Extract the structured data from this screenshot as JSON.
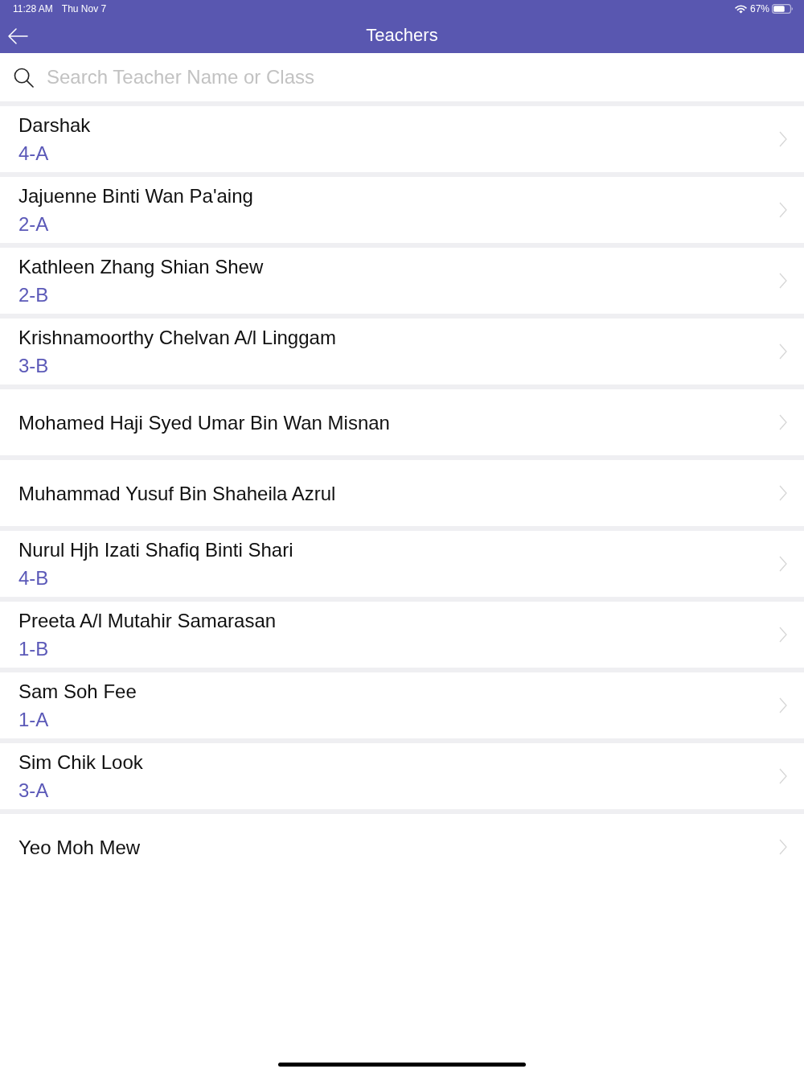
{
  "status_bar": {
    "time": "11:28 AM",
    "date": "Thu Nov 7",
    "battery": "67%"
  },
  "nav_bar": {
    "title": "Teachers"
  },
  "search": {
    "placeholder": "Search Teacher Name or Class"
  },
  "teachers": [
    {
      "name": "Darshak",
      "class": "4-A"
    },
    {
      "name": "Jajuenne Binti Wan Pa'aing",
      "class": "2-A"
    },
    {
      "name": "Kathleen Zhang Shian Shew",
      "class": "2-B"
    },
    {
      "name": "Krishnamoorthy Chelvan A/l Linggam",
      "class": "3-B"
    },
    {
      "name": "Mohamed Haji Syed Umar Bin Wan Misnan"
    },
    {
      "name": "Muhammad Yusuf Bin Shaheila Azrul"
    },
    {
      "name": "Nurul Hjh Izati Shafiq Binti Shari",
      "class": "4-B"
    },
    {
      "name": "Preeta A/l Mutahir Samarasan",
      "class": "1-B"
    },
    {
      "name": "Sam Soh Fee",
      "class": "1-A"
    },
    {
      "name": "Sim Chik Look",
      "class": "3-A"
    },
    {
      "name": "Yeo Moh Mew"
    }
  ]
}
